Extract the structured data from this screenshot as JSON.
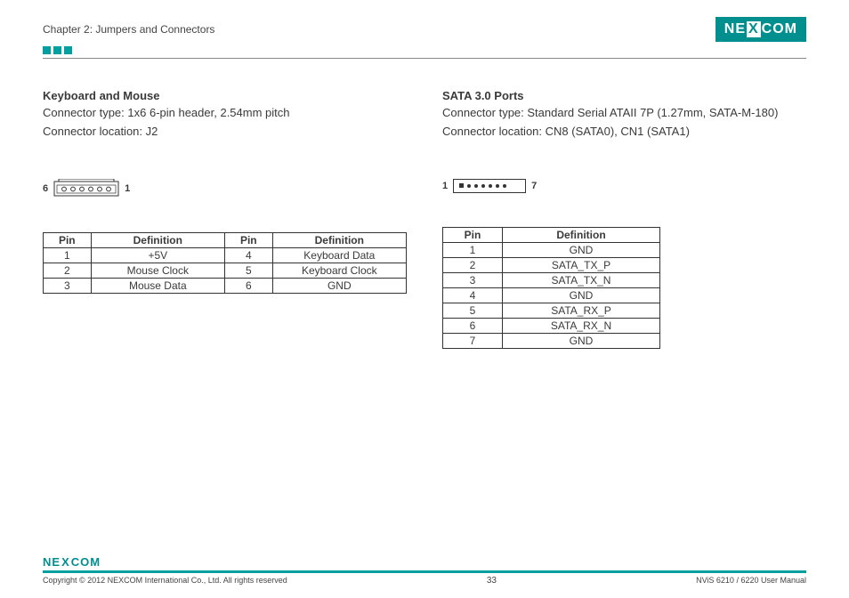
{
  "header": {
    "chapter": "Chapter 2: Jumpers and Connectors",
    "logo": {
      "left": "NE",
      "mid": "X",
      "right": "COM"
    }
  },
  "left": {
    "title": "Keyboard and Mouse",
    "type": "Connector type: 1x6 6-pin header, 2.54mm pitch",
    "loc": "Connector location: J2",
    "pin_left": "6",
    "pin_right": "1",
    "th": {
      "p1": "Pin",
      "d1": "Definition",
      "p2": "Pin",
      "d2": "Definition"
    },
    "rows": [
      {
        "p1": "1",
        "d1": "+5V",
        "p2": "4",
        "d2": "Keyboard Data"
      },
      {
        "p1": "2",
        "d1": "Mouse Clock",
        "p2": "5",
        "d2": "Keyboard Clock"
      },
      {
        "p1": "3",
        "d1": "Mouse Data",
        "p2": "6",
        "d2": "GND"
      }
    ]
  },
  "right": {
    "title": "SATA 3.0 Ports",
    "type": "Connector type: Standard Serial ATAII 7P (1.27mm, SATA-M-180)",
    "loc": "Connector location: CN8 (SATA0), CN1 (SATA1)",
    "pin_left": "1",
    "pin_right": "7",
    "th": {
      "p": "Pin",
      "d": "Definition"
    },
    "rows": [
      {
        "p": "1",
        "d": "GND"
      },
      {
        "p": "2",
        "d": "SATA_TX_P"
      },
      {
        "p": "3",
        "d": "SATA_TX_N"
      },
      {
        "p": "4",
        "d": "GND"
      },
      {
        "p": "5",
        "d": "SATA_RX_P"
      },
      {
        "p": "6",
        "d": "SATA_RX_N"
      },
      {
        "p": "7",
        "d": "GND"
      }
    ]
  },
  "footer": {
    "logo": {
      "left": "NE",
      "mid": "X",
      "right": "COM"
    },
    "copyright": "Copyright © 2012 NEXCOM International Co., Ltd. All rights reserved",
    "page": "33",
    "manual": "NViS 6210 / 6220 User Manual"
  }
}
